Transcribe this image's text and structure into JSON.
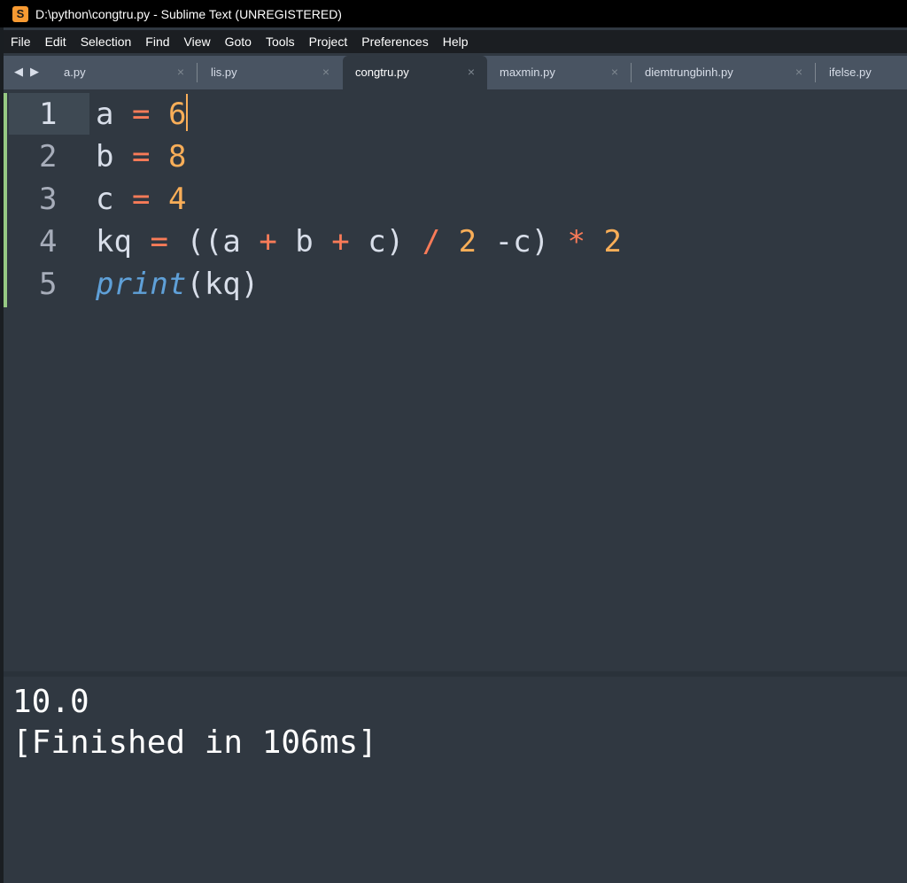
{
  "window": {
    "title": "D:\\python\\congtru.py - Sublime Text (UNREGISTERED)",
    "icon_glyph": "S"
  },
  "menu": [
    "File",
    "Edit",
    "Selection",
    "Find",
    "View",
    "Goto",
    "Tools",
    "Project",
    "Preferences",
    "Help"
  ],
  "nav": {
    "prev": "◀",
    "next": "▶"
  },
  "tabs": [
    {
      "label": "a.py",
      "close": "×",
      "active": false
    },
    {
      "label": "lis.py",
      "close": "×",
      "active": false
    },
    {
      "label": "congtru.py",
      "close": "×",
      "active": true
    },
    {
      "label": "maxmin.py",
      "close": "×",
      "active": false
    },
    {
      "label": "diemtrungbinh.py",
      "close": "×",
      "active": false
    },
    {
      "label": "ifelse.py",
      "close": "",
      "active": false
    }
  ],
  "editor": {
    "line_numbers": [
      "1",
      "2",
      "3",
      "4",
      "5"
    ],
    "current_line": "1",
    "code": {
      "line1": [
        "a",
        "=",
        "6"
      ],
      "line2": [
        "b",
        "=",
        "8"
      ],
      "line3": [
        "c",
        "=",
        "4"
      ],
      "line4": [
        "kq",
        "=",
        "((",
        "a",
        "+",
        "b",
        "+",
        "c",
        ")",
        "/",
        "2",
        "-c)",
        "*",
        "2"
      ],
      "line5": [
        "print",
        "(kq)"
      ]
    }
  },
  "colors": {
    "background": "#303841",
    "text": "#d8dee9",
    "operator": "#f97b58",
    "number": "#f9ae58",
    "builtin": "#5fa0d8",
    "modified_bar": "#96c983"
  },
  "output": {
    "lines": [
      "10.0",
      "[Finished in 106ms]"
    ]
  }
}
